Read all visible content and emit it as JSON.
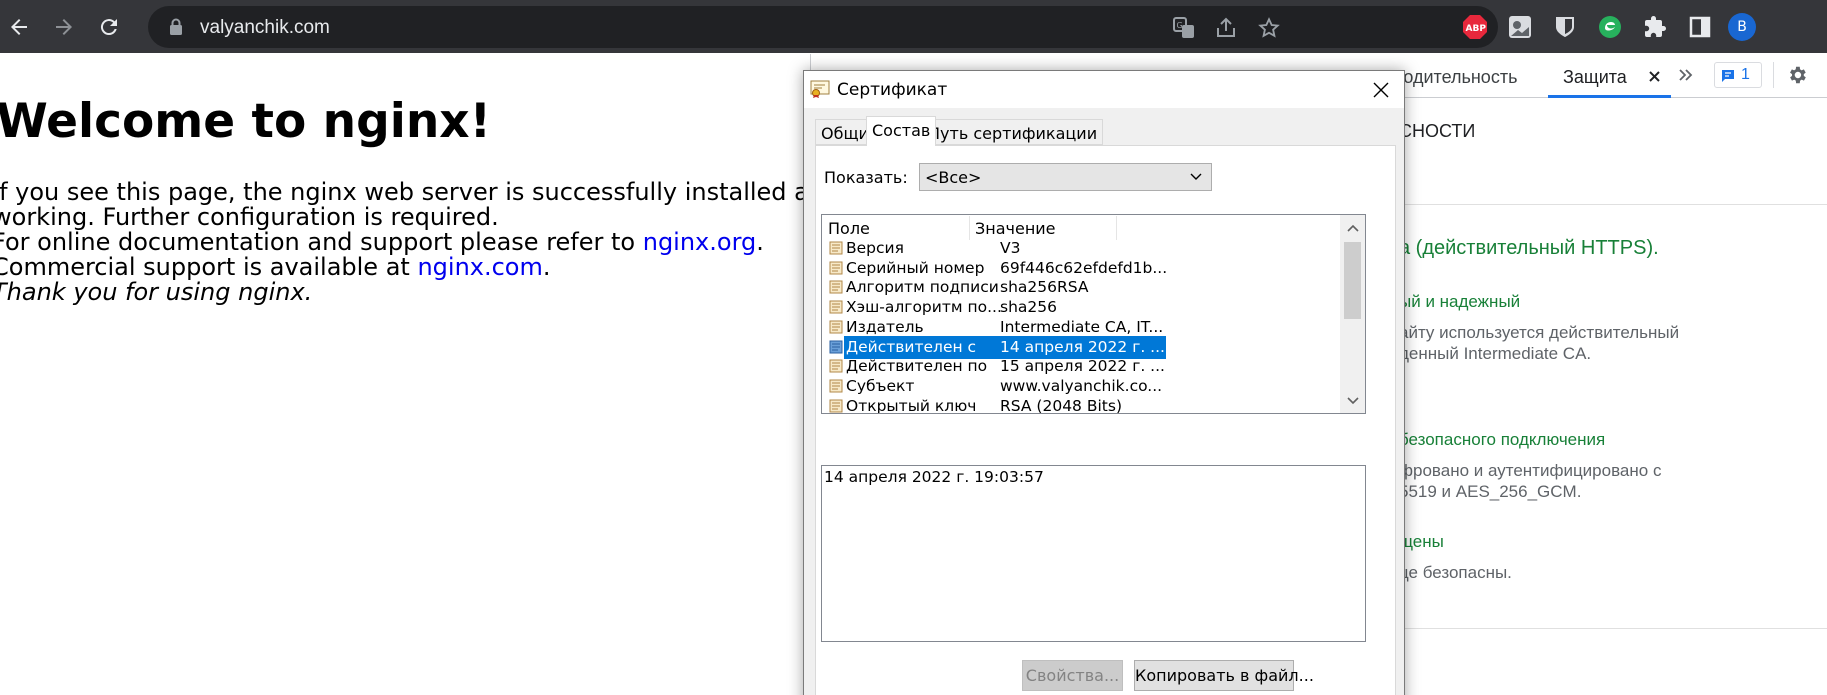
{
  "browser": {
    "url": "valyanchik.com",
    "profile_initial": "В"
  },
  "page": {
    "heading": "Welcome to nginx!",
    "para1_line1": "If you see this page, the nginx web server is successfully installed and",
    "para1_line2": "working. Further configuration is required.",
    "para2_prefix": "For online documentation and support please refer to ",
    "para2_link": "nginx.org",
    "para2_suffix": ".",
    "para3_prefix": "Commercial support is available at ",
    "para3_link": "nginx.com",
    "para3_suffix": ".",
    "para4": "Thank you for using nginx."
  },
  "devtools": {
    "tabs": [
      "водительность",
      "Защита"
    ],
    "issues_count": "1",
    "heading": "СНОСТИ",
    "https_status": "а (действительный HTTPS).",
    "cert_title": "ый и надежный",
    "cert_desc_1": "айту используется действительный",
    "cert_desc_2": "денный Intermediate CA.",
    "conn_title": "безопасного подключения",
    "conn_desc_1": "фровано и аутентифицировано с",
    "conn_desc_2": "5519 и AES_256_GCM.",
    "res_title": "щены",
    "res_desc": "це безопасны."
  },
  "dialog": {
    "title": "Сертификат",
    "tabs": [
      "Общие",
      "Состав",
      "Путь сертификации"
    ],
    "active_tab": "Состав",
    "show_label": "Показать:",
    "show_value": "<Все>",
    "columns": [
      "Поле",
      "Значение"
    ],
    "rows": [
      {
        "field": "Версия",
        "value": "V3"
      },
      {
        "field": "Серийный номер",
        "value": "69f446c62efdefd1b..."
      },
      {
        "field": "Алгоритм подписи",
        "value": "sha256RSA"
      },
      {
        "field": "Хэш-алгоритм по...",
        "value": "sha256"
      },
      {
        "field": "Издатель",
        "value": "Intermediate CA, IT..."
      },
      {
        "field": "Действителен с",
        "value": "14 апреля 2022 г. ..."
      },
      {
        "field": "Действителен по",
        "value": "15 апреля 2022 г. ..."
      },
      {
        "field": "Субъект",
        "value": "www.valyanchik.co..."
      },
      {
        "field": "Открытый ключ",
        "value": "RSA (2048 Bits)"
      }
    ],
    "selected_row": "Действителен с",
    "detail_text": "14 апреля 2022 г. 19:03:57",
    "buttons": {
      "properties": "Свойства...",
      "copy_to_file": "Копировать в файл..."
    }
  },
  "colors": {
    "selection": "#0078d7",
    "link": "#0000ee",
    "secure_green": "#188038",
    "devtools_accent": "#1a73e8"
  }
}
